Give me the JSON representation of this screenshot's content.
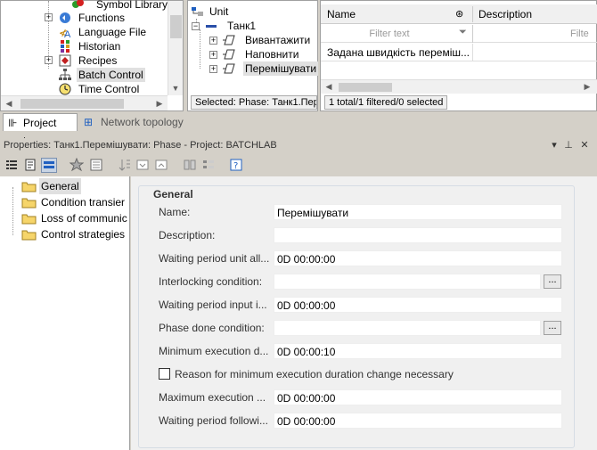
{
  "project_tree": {
    "items": [
      {
        "label": "Symbol Library"
      },
      {
        "label": "Functions"
      },
      {
        "label": "Language File"
      },
      {
        "label": "Historian"
      },
      {
        "label": "Recipes"
      },
      {
        "label": "Batch Control"
      },
      {
        "label": "Time Control"
      }
    ]
  },
  "unit_tree": {
    "root": "Unit",
    "unit": "Танк1",
    "phases": [
      "Вивантажити",
      "Наповнити",
      "Перемішувати"
    ],
    "status": "Selected: Phase: Танк1.Пер"
  },
  "grid": {
    "columns": [
      "Name",
      "Description"
    ],
    "filter_placeholder": "Filter text",
    "filter_placeholder_2": "Filte",
    "row": "Задана швидкість переміш...",
    "status": "1 total/1 filtered/0 selected"
  },
  "tabs": [
    {
      "label": "Project tree",
      "active": true
    },
    {
      "label": "Network topology",
      "active": false
    }
  ],
  "properties": {
    "title": "Properties: Танк1.Перемішувати: Phase - Project: BATCHLAB",
    "titlebar_buttons": {
      "dropdown": "▾",
      "pin": "⊥",
      "close": "✕"
    },
    "nav": [
      {
        "label": "General",
        "selected": true
      },
      {
        "label": "Condition transier"
      },
      {
        "label": "Loss of communic"
      },
      {
        "label": "Control strategies"
      }
    ],
    "group_title": "General",
    "fields": [
      {
        "label": "Name:",
        "value": "Перемішувати"
      },
      {
        "label": "Description:",
        "value": ""
      },
      {
        "label": "Waiting period unit all...",
        "value": "0D 00:00:00"
      },
      {
        "label": "Interlocking condition:",
        "value": "",
        "button": "..."
      },
      {
        "label": "Waiting period input i...",
        "value": "0D 00:00:00"
      },
      {
        "label": "Phase done condition:",
        "value": "",
        "button": "..."
      },
      {
        "label": "Minimum execution d...",
        "value": "0D 00:00:10"
      }
    ],
    "checkbox_label": "Reason for minimum execution duration change necessary",
    "fields2": [
      {
        "label": "Maximum execution ...",
        "value": "0D 00:00:00"
      },
      {
        "label": "Waiting period followi...",
        "value": "0D 00:00:00"
      }
    ]
  }
}
